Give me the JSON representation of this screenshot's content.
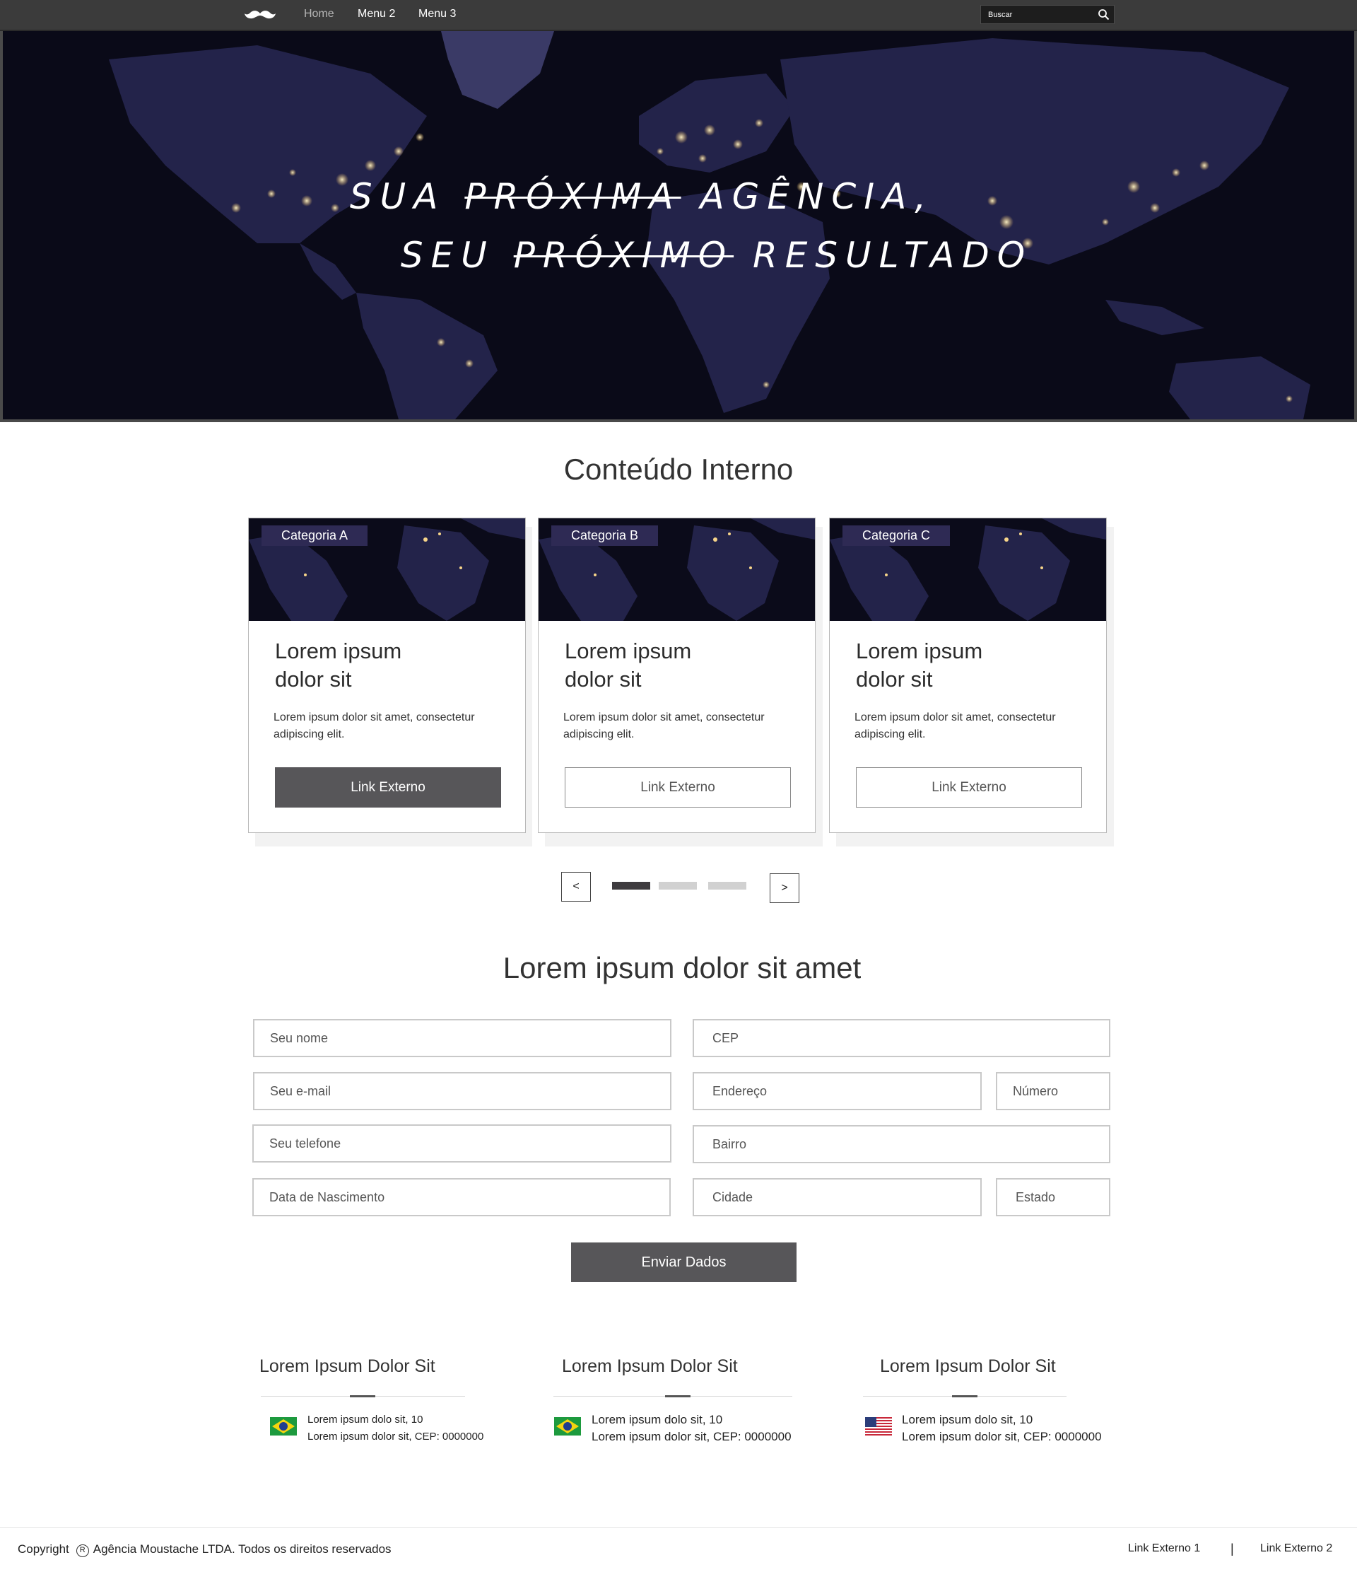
{
  "nav": {
    "logo_icon": "moustache-logo-icon",
    "items": [
      "Home",
      "Menu 2",
      "Menu 3"
    ],
    "search_placeholder": "Buscar",
    "search_icon": "search-icon"
  },
  "hero": {
    "line1": {
      "before": "SUA ",
      "strike": "PRÓXIMA",
      "after": " AGÊNCIA,"
    },
    "line2": {
      "before": "SEU ",
      "strike": "PRÓXIMO",
      "after": " RESULTADO"
    }
  },
  "content": {
    "title": "Conteúdo Interno",
    "cards": [
      {
        "category": "Categoria A",
        "title_line1": "Lorem ipsum",
        "title_line2": "dolor sit",
        "text": "Lorem ipsum dolor sit amet, consectetur adipiscing elit.",
        "button": "Link Externo",
        "button_style": "filled"
      },
      {
        "category": "Categoria B",
        "title_line1": "Lorem ipsum",
        "title_line2": "dolor sit",
        "text": "Lorem ipsum dolor sit amet, consectetur adipiscing elit.",
        "button": "Link Externo",
        "button_style": "outline"
      },
      {
        "category": "Categoria C",
        "title_line1": "Lorem ipsum",
        "title_line2": "dolor sit",
        "text": "Lorem ipsum dolor sit amet, consectetur adipiscing elit.",
        "button": "Link Externo",
        "button_style": "outline"
      }
    ],
    "carousel": {
      "prev": "<",
      "next": ">",
      "pages": 3,
      "active_page": 1
    }
  },
  "form": {
    "title": "Lorem ipsum dolor sit amet",
    "fields": {
      "name": "Seu nome",
      "email": "Seu e-mail",
      "phone": "Seu telefone",
      "birth": "Data de Nascimento",
      "cep": "CEP",
      "address": "Endereço",
      "number": "Número",
      "district": "Bairro",
      "city": "Cidade",
      "state": "Estado"
    },
    "submit": "Enviar Dados"
  },
  "offices": [
    {
      "title": "Lorem Ipsum Dolor Sit",
      "flag": "brazil-flag-icon",
      "line1": "Lorem ipsum dolo sit, 10",
      "line2": "Lorem ipsum dolor sit, CEP: 0000000"
    },
    {
      "title": "Lorem Ipsum Dolor Sit",
      "flag": "brazil-flag-icon",
      "line1": "Lorem ipsum dolo sit, 10",
      "line2": "Lorem ipsum dolor sit, CEP: 0000000"
    },
    {
      "title": "Lorem Ipsum Dolor Sit",
      "flag": "usa-flag-icon",
      "line1": "Lorem ipsum dolo sit, 10",
      "line2": "Lorem ipsum dolor sit, CEP: 0000000"
    }
  ],
  "footer": {
    "copyright_label": "Copyright",
    "registered_symbol": "R",
    "company": "Agência Moustache LTDA. Todos os direitos reservados",
    "link1": "Link Externo 1",
    "separator": "|",
    "link2": "Link Externo 2"
  },
  "colors": {
    "navbar": "#3b3b3b",
    "hero_bg": "#0a0a18",
    "badge": "#2e2a54",
    "button_dark": "#575659",
    "dot_active": "#3e3c3f",
    "dot_inactive": "#d1d1d1"
  }
}
